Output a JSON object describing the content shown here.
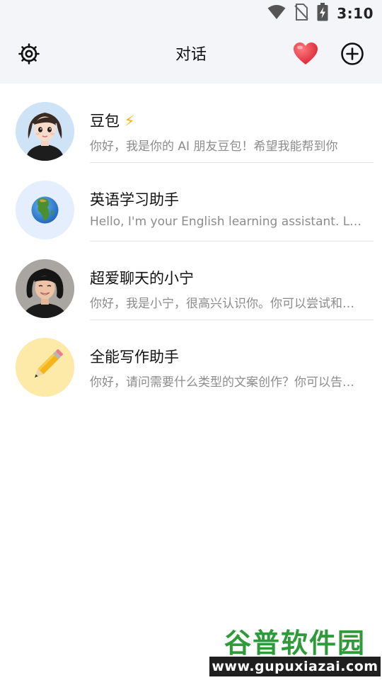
{
  "status_bar": {
    "time": "3:10",
    "icons": [
      "wifi-icon",
      "no-sim-icon",
      "battery-charging-icon"
    ]
  },
  "header": {
    "title": "对话",
    "left_icon": "gear-icon",
    "right_icons": [
      "heart-icon",
      "plus-circle-icon"
    ]
  },
  "conversations": [
    {
      "name": "豆包",
      "name_badge": "⚡",
      "preview": "你好，我是你的 AI 朋友豆包！希望我能帮到你",
      "avatar": "cartoon-girl-avatar"
    },
    {
      "name": "英语学习助手",
      "preview": "Hello, I'm your English learning assistant. Let's learn together",
      "avatar": "globe-avatar"
    },
    {
      "name": "超爱聊天的小宁",
      "preview": "你好，我是小宁，很高兴认识你。你可以尝试和我聊天",
      "avatar": "photo-girl-avatar"
    },
    {
      "name": "全能写作助手",
      "preview": "你好，请问需要什么类型的文案创作？你可以告诉我",
      "avatar": "pencil-avatar"
    }
  ],
  "watermark": {
    "title": "谷普软件园",
    "url": "www.gupuxiazai.com"
  },
  "colors": {
    "header_bg": "#f4f5f8",
    "preview_text": "#8c8c8c",
    "heart": "#e8323c",
    "watermark_green": "#2f9a3a"
  }
}
